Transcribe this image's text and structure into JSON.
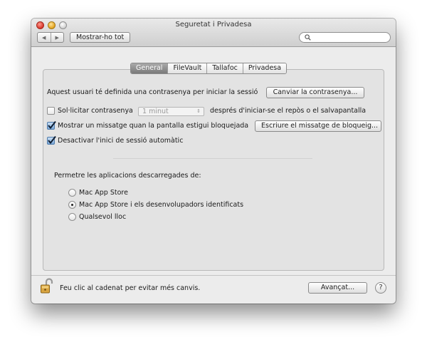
{
  "window": {
    "title": "Seguretat i Privadesa",
    "show_all_label": "Mostrar-ho tot",
    "search": {
      "placeholder": ""
    },
    "nav_back_glyph": "◀",
    "nav_forward_glyph": "▶"
  },
  "tabs": [
    {
      "label": "General",
      "active": true
    },
    {
      "label": "FileVault",
      "active": false
    },
    {
      "label": "Tallafoc",
      "active": false
    },
    {
      "label": "Privadesa",
      "active": false
    }
  ],
  "general": {
    "password_text": "Aquest usuari té definida una contrasenya per iniciar la sessió",
    "change_password_label": "Canviar la contrasenya...",
    "require_password": {
      "label": "Sol·licitar contrasenya",
      "checked": false,
      "select_value": "1 minut",
      "select_arrows": "⇕",
      "suffix": "després d'iniciar-se el repòs o el salvapantalla"
    },
    "show_message": {
      "label": "Mostrar un missatge quan la pantalla estigui bloquejada",
      "checked": true,
      "button_label": "Escriure el missatge de bloqueig..."
    },
    "disable_autologin": {
      "label": "Desactivar l'inici de sessió automàtic",
      "checked": true
    },
    "allow_apps": {
      "heading": "Permetre les aplicacions descarregades de:",
      "options": [
        {
          "label": "Mac App Store",
          "selected": false
        },
        {
          "label": "Mac App Store i els desenvolupadors identificats",
          "selected": true
        },
        {
          "label": "Qualsevol lloc",
          "selected": false
        }
      ]
    }
  },
  "footer": {
    "lock_text": "Feu clic al cadenat per evitar més canvis.",
    "advanced_label": "Avançat...",
    "help_label": "?"
  },
  "colors": {
    "tab_active": "#8f8f8f",
    "checkbox_checked": "#7aa8d8",
    "lock_gold": "#d9a541"
  }
}
